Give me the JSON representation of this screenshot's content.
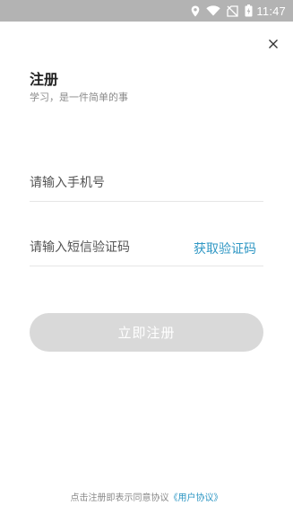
{
  "status_bar": {
    "time": "11:47",
    "icons": [
      "location-icon",
      "wifi-icon",
      "no-sim-icon",
      "battery-icon"
    ],
    "background": "#b3b3b3"
  },
  "close_icon": "close-icon",
  "header": {
    "title": "注册",
    "subtitle": "学习，是一件简单的事"
  },
  "form": {
    "phone_placeholder": "请输入手机号",
    "code_placeholder": "请输入短信验证码",
    "get_code_label": "获取验证码",
    "submit_label": "立即注册"
  },
  "footer": {
    "agreement_prefix": "点击注册即表示同意协议",
    "agreement_link": "《用户协议》"
  },
  "colors": {
    "accent": "#2f97c4",
    "button_disabled": "#d9d9d9",
    "title": "#222222",
    "subtle_text": "#8a8a8a"
  }
}
